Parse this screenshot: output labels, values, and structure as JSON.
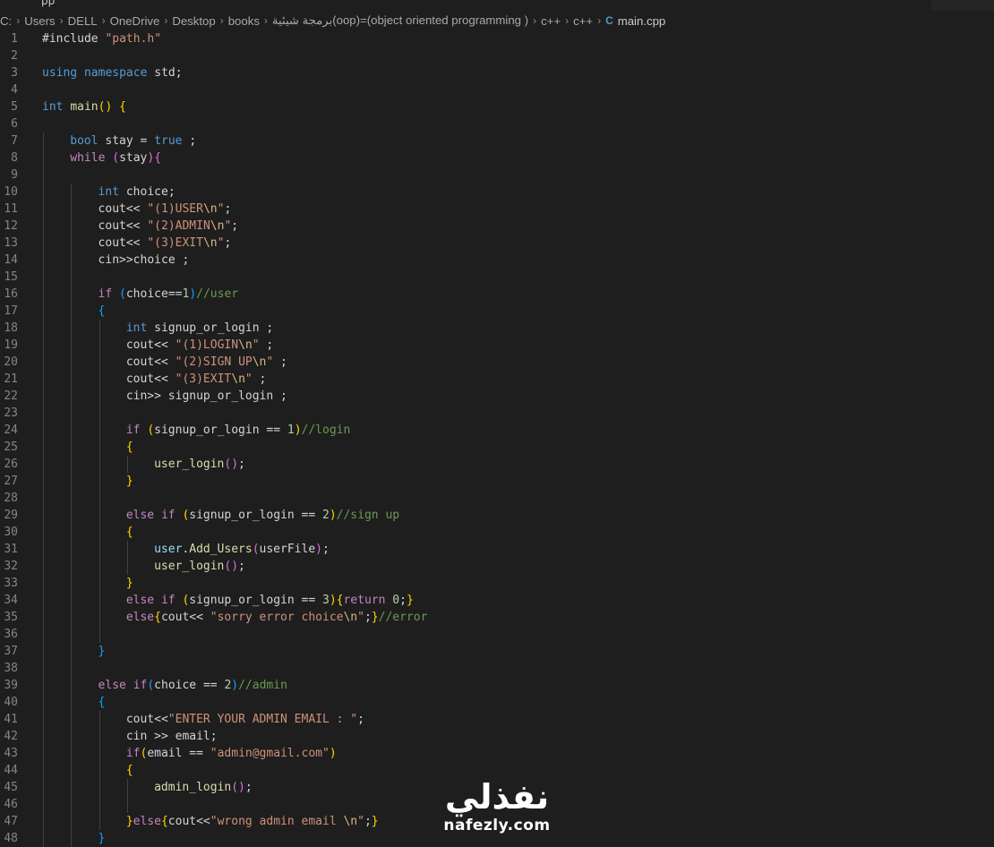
{
  "tab": {
    "fragment": "pp"
  },
  "breadcrumb": {
    "items": [
      "C:",
      "Users",
      "DELL",
      "OneDrive",
      "Desktop",
      "books",
      "برمجة شيئية(oop)=(object oriented programming )",
      "c++",
      "c++"
    ],
    "file_icon": "C",
    "file": "main.cpp"
  },
  "editor": {
    "lines": [
      {
        "n": "1",
        "indent": 0,
        "t": [
          [
            "p",
            "#include "
          ],
          [
            "s",
            "\"path.h\""
          ]
        ]
      },
      {
        "n": "2",
        "indent": 0,
        "t": []
      },
      {
        "n": "3",
        "indent": 0,
        "t": [
          [
            "k",
            "using"
          ],
          [
            "p",
            " "
          ],
          [
            "k",
            "namespace"
          ],
          [
            "p",
            " std;"
          ]
        ]
      },
      {
        "n": "4",
        "indent": 0,
        "t": []
      },
      {
        "n": "5",
        "indent": 0,
        "t": [
          [
            "k",
            "int"
          ],
          [
            "p",
            " "
          ],
          [
            "f",
            "main"
          ],
          [
            "y",
            "()"
          ],
          [
            "p",
            " "
          ],
          [
            "y",
            "{"
          ]
        ]
      },
      {
        "n": "6",
        "indent": 0,
        "t": []
      },
      {
        "n": "7",
        "indent": 1,
        "t": [
          [
            "k",
            "bool"
          ],
          [
            "p",
            " stay = "
          ],
          [
            "k",
            "true"
          ],
          [
            "p",
            " ;"
          ]
        ]
      },
      {
        "n": "8",
        "indent": 1,
        "t": [
          [
            "c",
            "while"
          ],
          [
            "p",
            " "
          ],
          [
            "m",
            "("
          ],
          [
            "p",
            "stay"
          ],
          [
            "m",
            ")"
          ],
          [
            "m",
            "{"
          ]
        ]
      },
      {
        "n": "9",
        "indent": 1,
        "t": []
      },
      {
        "n": "10",
        "indent": 2,
        "t": [
          [
            "k",
            "int"
          ],
          [
            "p",
            " choice;"
          ]
        ]
      },
      {
        "n": "11",
        "indent": 2,
        "t": [
          [
            "p",
            "cout<< "
          ],
          [
            "s",
            "\"(1)USER"
          ],
          [
            "e",
            "\\n"
          ],
          [
            "s",
            "\""
          ],
          [
            "p",
            ";"
          ]
        ]
      },
      {
        "n": "12",
        "indent": 2,
        "t": [
          [
            "p",
            "cout<< "
          ],
          [
            "s",
            "\"(2)ADMIN"
          ],
          [
            "e",
            "\\n"
          ],
          [
            "s",
            "\""
          ],
          [
            "p",
            ";"
          ]
        ]
      },
      {
        "n": "13",
        "indent": 2,
        "t": [
          [
            "p",
            "cout<< "
          ],
          [
            "s",
            "\"(3)EXIT"
          ],
          [
            "e",
            "\\n"
          ],
          [
            "s",
            "\""
          ],
          [
            "p",
            ";"
          ]
        ]
      },
      {
        "n": "14",
        "indent": 2,
        "t": [
          [
            "p",
            "cin>>choice ;"
          ]
        ]
      },
      {
        "n": "15",
        "indent": 2,
        "t": []
      },
      {
        "n": "16",
        "indent": 2,
        "t": [
          [
            "c",
            "if"
          ],
          [
            "p",
            " "
          ],
          [
            "b",
            "("
          ],
          [
            "p",
            "choice=="
          ],
          [
            "n",
            "1"
          ],
          [
            "b",
            ")"
          ],
          [
            "cm",
            "//user"
          ]
        ]
      },
      {
        "n": "17",
        "indent": 2,
        "t": [
          [
            "b",
            "{"
          ]
        ]
      },
      {
        "n": "18",
        "indent": 3,
        "t": [
          [
            "k",
            "int"
          ],
          [
            "p",
            " signup_or_login ;"
          ]
        ]
      },
      {
        "n": "19",
        "indent": 3,
        "t": [
          [
            "p",
            "cout<< "
          ],
          [
            "s",
            "\"(1)LOGIN"
          ],
          [
            "e",
            "\\n"
          ],
          [
            "s",
            "\""
          ],
          [
            "p",
            " ;"
          ]
        ]
      },
      {
        "n": "20",
        "indent": 3,
        "t": [
          [
            "p",
            "cout<< "
          ],
          [
            "s",
            "\"(2)SIGN UP"
          ],
          [
            "e",
            "\\n"
          ],
          [
            "s",
            "\""
          ],
          [
            "p",
            " ;"
          ]
        ]
      },
      {
        "n": "21",
        "indent": 3,
        "t": [
          [
            "p",
            "cout<< "
          ],
          [
            "s",
            "\"(3)EXIT"
          ],
          [
            "e",
            "\\n"
          ],
          [
            "s",
            "\""
          ],
          [
            "p",
            " ;"
          ]
        ]
      },
      {
        "n": "22",
        "indent": 3,
        "t": [
          [
            "p",
            "cin>> signup_or_login ;"
          ]
        ]
      },
      {
        "n": "23",
        "indent": 3,
        "t": []
      },
      {
        "n": "24",
        "indent": 3,
        "t": [
          [
            "c",
            "if"
          ],
          [
            "p",
            " "
          ],
          [
            "y",
            "("
          ],
          [
            "p",
            "signup_or_login == "
          ],
          [
            "n",
            "1"
          ],
          [
            "y",
            ")"
          ],
          [
            "cm",
            "//login"
          ]
        ]
      },
      {
        "n": "25",
        "indent": 3,
        "t": [
          [
            "y",
            "{"
          ]
        ]
      },
      {
        "n": "26",
        "indent": 4,
        "t": [
          [
            "f",
            "user_login"
          ],
          [
            "m",
            "()"
          ],
          [
            "p",
            ";"
          ]
        ]
      },
      {
        "n": "27",
        "indent": 3,
        "t": [
          [
            "y",
            "}"
          ]
        ]
      },
      {
        "n": "28",
        "indent": 3,
        "t": []
      },
      {
        "n": "29",
        "indent": 3,
        "t": [
          [
            "c",
            "else"
          ],
          [
            "p",
            " "
          ],
          [
            "c",
            "if"
          ],
          [
            "p",
            " "
          ],
          [
            "y",
            "("
          ],
          [
            "p",
            "signup_or_login == "
          ],
          [
            "n",
            "2"
          ],
          [
            "y",
            ")"
          ],
          [
            "cm",
            "//sign up"
          ]
        ]
      },
      {
        "n": "30",
        "indent": 3,
        "t": [
          [
            "y",
            "{"
          ]
        ]
      },
      {
        "n": "31",
        "indent": 4,
        "t": [
          [
            "v",
            "user"
          ],
          [
            "p",
            "."
          ],
          [
            "f",
            "Add_Users"
          ],
          [
            "m",
            "("
          ],
          [
            "p",
            "userFile"
          ],
          [
            "m",
            ")"
          ],
          [
            "p",
            ";"
          ]
        ]
      },
      {
        "n": "32",
        "indent": 4,
        "t": [
          [
            "f",
            "user_login"
          ],
          [
            "m",
            "()"
          ],
          [
            "p",
            ";"
          ]
        ]
      },
      {
        "n": "33",
        "indent": 3,
        "t": [
          [
            "y",
            "}"
          ]
        ]
      },
      {
        "n": "34",
        "indent": 3,
        "t": [
          [
            "c",
            "else"
          ],
          [
            "p",
            " "
          ],
          [
            "c",
            "if"
          ],
          [
            "p",
            " "
          ],
          [
            "y",
            "("
          ],
          [
            "p",
            "signup_or_login == "
          ],
          [
            "n",
            "3"
          ],
          [
            "y",
            ")"
          ],
          [
            "y",
            "{"
          ],
          [
            "c",
            "return"
          ],
          [
            "p",
            " "
          ],
          [
            "n",
            "0"
          ],
          [
            "p",
            ";"
          ],
          [
            "y",
            "}"
          ]
        ]
      },
      {
        "n": "35",
        "indent": 3,
        "t": [
          [
            "c",
            "else"
          ],
          [
            "y",
            "{"
          ],
          [
            "p",
            "cout<< "
          ],
          [
            "s",
            "\"sorry error choice"
          ],
          [
            "e",
            "\\n"
          ],
          [
            "s",
            "\""
          ],
          [
            "p",
            ";"
          ],
          [
            "y",
            "}"
          ],
          [
            "cm",
            "//error"
          ]
        ]
      },
      {
        "n": "36",
        "indent": 3,
        "t": []
      },
      {
        "n": "37",
        "indent": 2,
        "t": [
          [
            "b",
            "}"
          ]
        ]
      },
      {
        "n": "38",
        "indent": 2,
        "t": []
      },
      {
        "n": "39",
        "indent": 2,
        "t": [
          [
            "c",
            "else"
          ],
          [
            "p",
            " "
          ],
          [
            "c",
            "if"
          ],
          [
            "b",
            "("
          ],
          [
            "p",
            "choice == "
          ],
          [
            "n",
            "2"
          ],
          [
            "b",
            ")"
          ],
          [
            "cm",
            "//admin"
          ]
        ]
      },
      {
        "n": "40",
        "indent": 2,
        "t": [
          [
            "b",
            "{"
          ]
        ]
      },
      {
        "n": "41",
        "indent": 3,
        "t": [
          [
            "p",
            "cout<<"
          ],
          [
            "s",
            "\"ENTER YOUR ADMIN EMAIL : \""
          ],
          [
            "p",
            ";"
          ]
        ]
      },
      {
        "n": "42",
        "indent": 3,
        "t": [
          [
            "p",
            "cin >> email;"
          ]
        ]
      },
      {
        "n": "43",
        "indent": 3,
        "t": [
          [
            "c",
            "if"
          ],
          [
            "y",
            "("
          ],
          [
            "p",
            "email == "
          ],
          [
            "s",
            "\"admin@gmail.com\""
          ],
          [
            "y",
            ")"
          ]
        ]
      },
      {
        "n": "44",
        "indent": 3,
        "t": [
          [
            "y",
            "{"
          ]
        ]
      },
      {
        "n": "45",
        "indent": 4,
        "t": [
          [
            "f",
            "admin_login"
          ],
          [
            "m",
            "()"
          ],
          [
            "p",
            ";"
          ]
        ]
      },
      {
        "n": "46",
        "indent": 4,
        "t": []
      },
      {
        "n": "47",
        "indent": 3,
        "t": [
          [
            "y",
            "}"
          ],
          [
            "c",
            "else"
          ],
          [
            "y",
            "{"
          ],
          [
            "p",
            "cout<<"
          ],
          [
            "s",
            "\"wrong admin email "
          ],
          [
            "e",
            "\\n"
          ],
          [
            "s",
            "\""
          ],
          [
            "p",
            ";"
          ],
          [
            "y",
            "}"
          ]
        ]
      },
      {
        "n": "48",
        "indent": 2,
        "t": [
          [
            "b",
            "}"
          ]
        ]
      }
    ]
  },
  "watermark": {
    "arabic": "نفذلي",
    "latin": "nafezly.com"
  }
}
